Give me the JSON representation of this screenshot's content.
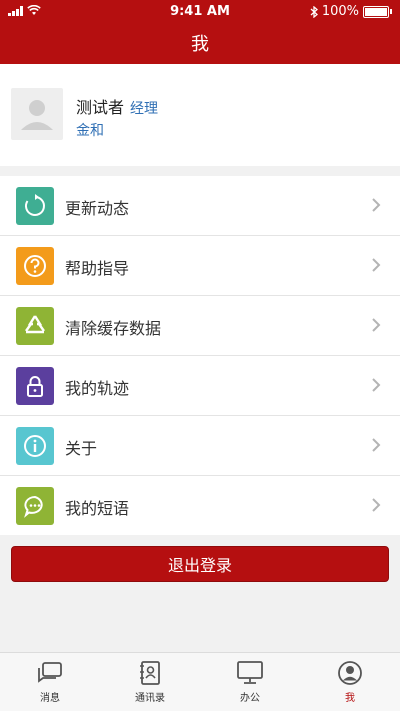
{
  "statusbar": {
    "time": "9:41 AM",
    "battery": "100%"
  },
  "header": {
    "title": "我"
  },
  "profile": {
    "name": "测试者",
    "role": "经理",
    "company": "金和"
  },
  "menu": {
    "items": [
      {
        "label": "更新动态",
        "icon": "refresh-icon",
        "color": "#3fae93"
      },
      {
        "label": "帮助指导",
        "icon": "question-icon",
        "color": "#f39b1b"
      },
      {
        "label": "清除缓存数据",
        "icon": "recycle-icon",
        "color": "#8fb435"
      },
      {
        "label": "我的轨迹",
        "icon": "lock-icon",
        "color": "#5b3f9e"
      },
      {
        "label": "关于",
        "icon": "info-icon",
        "color": "#58c6d0"
      },
      {
        "label": "我的短语",
        "icon": "chat-icon",
        "color": "#8fb435"
      }
    ]
  },
  "logout_label": "退出登录",
  "tabbar": {
    "tabs": [
      {
        "label": "消息",
        "icon": "message-icon"
      },
      {
        "label": "通讯录",
        "icon": "contacts-icon"
      },
      {
        "label": "办公",
        "icon": "monitor-icon"
      },
      {
        "label": "我",
        "icon": "user-icon",
        "active": true
      }
    ]
  },
  "colors": {
    "brand": "#b50f10",
    "link": "#2f6fb4"
  }
}
